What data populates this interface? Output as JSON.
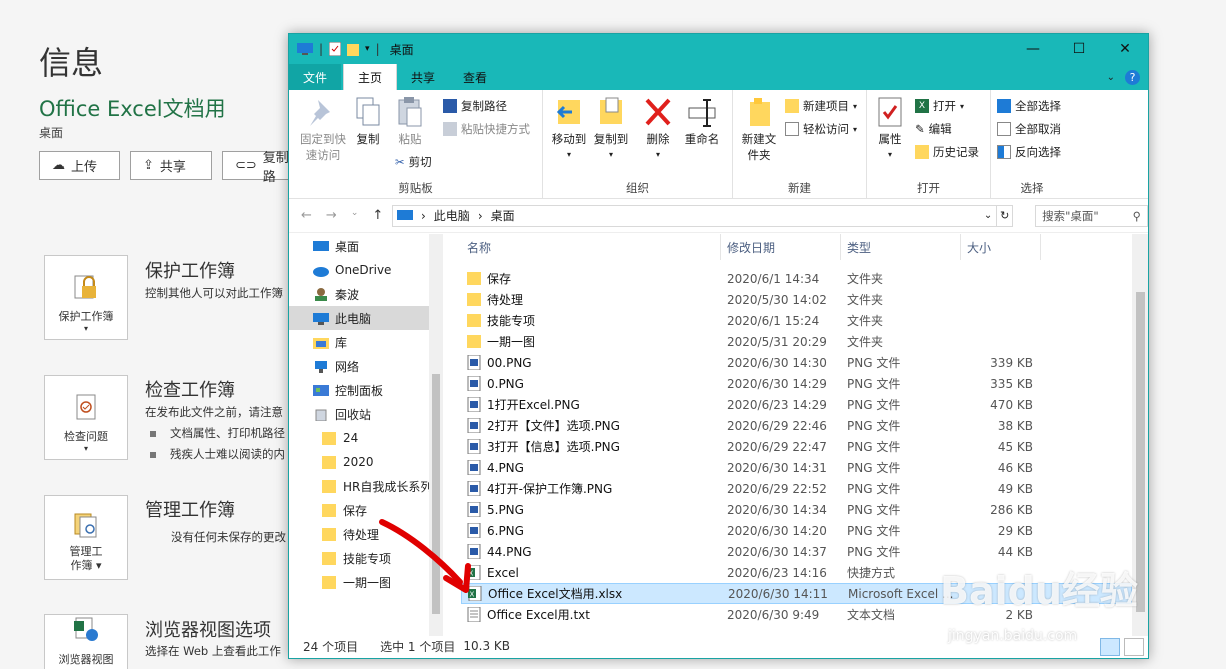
{
  "background": {
    "title": "信息",
    "doc_name": "Office Excel文档用",
    "location": "桌面",
    "buttons": [
      {
        "label": "上传",
        "icon": "upload-icon"
      },
      {
        "label": "共享",
        "icon": "share-icon"
      },
      {
        "label": "复制路",
        "icon": "link-icon"
      }
    ],
    "sections": [
      {
        "card": "保护工作簿",
        "title": "保护工作簿",
        "text": "控制其他人可以对此工作簿",
        "bullets": []
      },
      {
        "card": "检查问题",
        "title": "检查工作簿",
        "text": "在发布此文件之前，请注意",
        "bullets": [
          "文档属性、打印机路径",
          "残疾人士难以阅读的内"
        ]
      },
      {
        "card": "管理工作簿",
        "title": "管理工作簿",
        "text": "没有任何未保存的更改",
        "bullets": []
      },
      {
        "card": "浏览器视图",
        "title": "浏览器视图选项",
        "text": "选择在 Web 上查看此工作",
        "bullets": []
      }
    ]
  },
  "window": {
    "title": "桌面",
    "controls": [
      "—",
      "☐",
      "✕"
    ],
    "tabs": [
      "文件",
      "主页",
      "共享",
      "查看"
    ],
    "ribbon": {
      "clipboard": {
        "label": "剪贴板",
        "pin": "固定到快速访问",
        "copy": "复制",
        "paste": "粘贴",
        "copy_path": "复制路径",
        "paste_shortcut": "粘贴快捷方式",
        "cut": "剪切"
      },
      "organize": {
        "label": "组织",
        "move_to": "移动到",
        "copy_to": "复制到",
        "delete": "删除",
        "rename": "重命名"
      },
      "new": {
        "label": "新建",
        "new_folder": "新建文件夹",
        "new_item": "新建项目",
        "easy_access": "轻松访问"
      },
      "open": {
        "label": "打开",
        "properties": "属性",
        "open": "打开",
        "edit": "编辑",
        "history": "历史记录"
      },
      "select": {
        "label": "选择",
        "select_all": "全部选择",
        "select_none": "全部取消",
        "invert": "反向选择"
      }
    },
    "address": {
      "parts": [
        "此电脑",
        "桌面"
      ],
      "search_placeholder": "搜索\"桌面\""
    },
    "nav_items": [
      {
        "label": "桌面",
        "icon": "desktop-icon"
      },
      {
        "label": "OneDrive",
        "icon": "cloud-icon"
      },
      {
        "label": "秦波",
        "icon": "user-icon"
      },
      {
        "label": "此电脑",
        "icon": "computer-icon",
        "selected": true
      },
      {
        "label": "库",
        "icon": "library-icon"
      },
      {
        "label": "网络",
        "icon": "network-icon"
      },
      {
        "label": "控制面板",
        "icon": "control-panel-icon"
      },
      {
        "label": "回收站",
        "icon": "recycle-bin-icon"
      },
      {
        "label": "24",
        "icon": "folder-icon"
      },
      {
        "label": "2020",
        "icon": "folder-icon"
      },
      {
        "label": "HR自我成长系列",
        "icon": "folder-icon"
      },
      {
        "label": "保存",
        "icon": "folder-icon"
      },
      {
        "label": "待处理",
        "icon": "folder-icon"
      },
      {
        "label": "技能专项",
        "icon": "folder-icon"
      },
      {
        "label": "一期一图",
        "icon": "folder-icon"
      }
    ],
    "columns": [
      "名称",
      "修改日期",
      "类型",
      "大小"
    ],
    "files": [
      {
        "name": "保存",
        "date": "2020/6/1 14:34",
        "type": "文件夹",
        "size": "",
        "icon": "folder"
      },
      {
        "name": "待处理",
        "date": "2020/5/30 14:02",
        "type": "文件夹",
        "size": "",
        "icon": "folder"
      },
      {
        "name": "技能专项",
        "date": "2020/6/1 15:24",
        "type": "文件夹",
        "size": "",
        "icon": "folder"
      },
      {
        "name": "一期一图",
        "date": "2020/5/31 20:29",
        "type": "文件夹",
        "size": "",
        "icon": "folder"
      },
      {
        "name": "00.PNG",
        "date": "2020/6/30 14:30",
        "type": "PNG 文件",
        "size": "339 KB",
        "icon": "png"
      },
      {
        "name": "0.PNG",
        "date": "2020/6/30 14:29",
        "type": "PNG 文件",
        "size": "335 KB",
        "icon": "png"
      },
      {
        "name": "1打开Excel.PNG",
        "date": "2020/6/23 14:29",
        "type": "PNG 文件",
        "size": "470 KB",
        "icon": "png"
      },
      {
        "name": "2打开【文件】选项.PNG",
        "date": "2020/6/29 22:46",
        "type": "PNG 文件",
        "size": "38 KB",
        "icon": "png"
      },
      {
        "name": "3打开【信息】选项.PNG",
        "date": "2020/6/29 22:47",
        "type": "PNG 文件",
        "size": "45 KB",
        "icon": "png"
      },
      {
        "name": "4.PNG",
        "date": "2020/6/30 14:31",
        "type": "PNG 文件",
        "size": "46 KB",
        "icon": "png"
      },
      {
        "name": "4打开-保护工作簿.PNG",
        "date": "2020/6/29 22:52",
        "type": "PNG 文件",
        "size": "49 KB",
        "icon": "png"
      },
      {
        "name": "5.PNG",
        "date": "2020/6/30 14:34",
        "type": "PNG 文件",
        "size": "286 KB",
        "icon": "png"
      },
      {
        "name": "6.PNG",
        "date": "2020/6/30 14:20",
        "type": "PNG 文件",
        "size": "29 KB",
        "icon": "png"
      },
      {
        "name": "44.PNG",
        "date": "2020/6/30 14:37",
        "type": "PNG 文件",
        "size": "44 KB",
        "icon": "png"
      },
      {
        "name": "Excel",
        "date": "2020/6/23 14:16",
        "type": "快捷方式",
        "size": "",
        "icon": "excel"
      },
      {
        "name": "Office Excel文档用.xlsx",
        "date": "2020/6/30 14:11",
        "type": "Microsoft Excel ...",
        "size": "",
        "icon": "excel",
        "selected": true
      },
      {
        "name": "Office Excel用.txt",
        "date": "2020/6/30 9:49",
        "type": "文本文档",
        "size": "2 KB",
        "icon": "txt"
      }
    ],
    "status": {
      "count": "24 个项目",
      "selection": "选中 1 个项目",
      "size": "10.3 KB"
    }
  },
  "watermark": {
    "text": "Baidu经验",
    "url": "jingyan.baidu.com"
  },
  "colors": {
    "titlebar": "#19b8b8",
    "accent_green": "#217346",
    "selection": "#cce8ff",
    "annotation_arrow": "#e00000"
  }
}
